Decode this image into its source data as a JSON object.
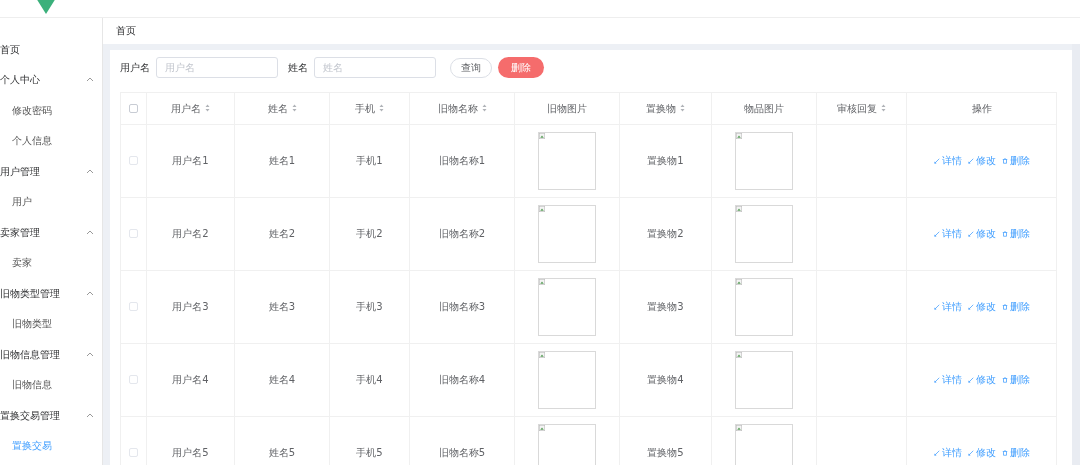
{
  "sidebar": {
    "items": [
      {
        "label": "首页",
        "selected": false
      },
      {
        "label": "个人中心",
        "expanded": true,
        "children": [
          {
            "label": "修改密码",
            "selected": false
          },
          {
            "label": "个人信息",
            "selected": false
          }
        ]
      },
      {
        "label": "用户管理",
        "expanded": true,
        "children": [
          {
            "label": "用户",
            "selected": false
          }
        ]
      },
      {
        "label": "卖家管理",
        "expanded": true,
        "children": [
          {
            "label": "卖家",
            "selected": false
          }
        ]
      },
      {
        "label": "旧物类型管理",
        "expanded": true,
        "children": [
          {
            "label": "旧物类型",
            "selected": false
          }
        ]
      },
      {
        "label": "旧物信息管理",
        "expanded": true,
        "children": [
          {
            "label": "旧物信息",
            "selected": false
          }
        ]
      },
      {
        "label": "置换交易管理",
        "expanded": true,
        "children": [
          {
            "label": "置换交易",
            "selected": true
          }
        ]
      }
    ]
  },
  "breadcrumb": "首页",
  "search": {
    "fields": [
      {
        "label": "用户名",
        "placeholder": "用户名"
      },
      {
        "label": "姓名",
        "placeholder": "姓名"
      }
    ],
    "query_button": "查询",
    "delete_button": "删除"
  },
  "table": {
    "select_all_checked": false,
    "columns": [
      {
        "label": "用户名",
        "sortable": true
      },
      {
        "label": "姓名",
        "sortable": true
      },
      {
        "label": "手机",
        "sortable": true
      },
      {
        "label": "旧物名称",
        "sortable": true
      },
      {
        "label": "旧物图片",
        "sortable": false
      },
      {
        "label": "置换物",
        "sortable": true
      },
      {
        "label": "物品图片",
        "sortable": false
      },
      {
        "label": "审核回复",
        "sortable": true
      },
      {
        "label": "操作",
        "sortable": false
      }
    ],
    "rows": [
      {
        "checked": false,
        "username": "用户名1",
        "name": "姓名1",
        "phone": "手机1",
        "item_name": "旧物名称1",
        "exchange_item": "置换物1",
        "actions": [
          "详情",
          "修改",
          "删除"
        ]
      },
      {
        "checked": false,
        "username": "用户名2",
        "name": "姓名2",
        "phone": "手机2",
        "item_name": "旧物名称2",
        "exchange_item": "置换物2",
        "actions": [
          "详情",
          "修改",
          "删除"
        ]
      },
      {
        "checked": false,
        "username": "用户名3",
        "name": "姓名3",
        "phone": "手机3",
        "item_name": "旧物名称3",
        "exchange_item": "置换物3",
        "actions": [
          "详情",
          "修改",
          "删除"
        ]
      },
      {
        "checked": false,
        "username": "用户名4",
        "name": "姓名4",
        "phone": "手机4",
        "item_name": "旧物名称4",
        "exchange_item": "置换物4",
        "actions": [
          "详情",
          "修改",
          "删除"
        ]
      },
      {
        "checked": false,
        "username": "用户名5",
        "name": "姓名5",
        "phone": "手机5",
        "item_name": "旧物名称5",
        "exchange_item": "置换物5",
        "actions": [
          "详情",
          "修改",
          "删除"
        ]
      }
    ]
  }
}
